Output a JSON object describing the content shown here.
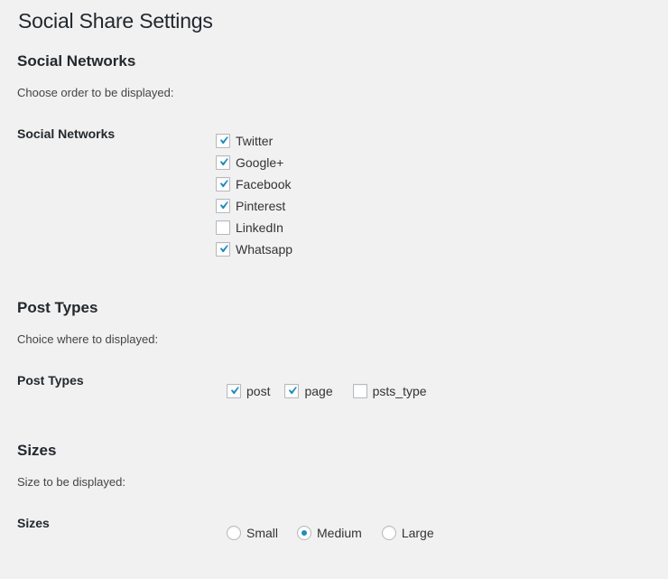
{
  "page": {
    "title": "Social Share Settings"
  },
  "social_networks": {
    "heading": "Social Networks",
    "description": "Choose order to be displayed:",
    "field_label": "Social Networks",
    "options": [
      {
        "label": "Twitter",
        "checked": true
      },
      {
        "label": "Google+",
        "checked": true
      },
      {
        "label": "Facebook",
        "checked": true
      },
      {
        "label": "Pinterest",
        "checked": true
      },
      {
        "label": "LinkedIn",
        "checked": false
      },
      {
        "label": "Whatsapp",
        "checked": true
      }
    ]
  },
  "post_types": {
    "heading": "Post Types",
    "description": "Choice where to displayed:",
    "field_label": "Post Types",
    "options": [
      {
        "label": "post",
        "checked": true
      },
      {
        "label": "page",
        "checked": true
      },
      {
        "label": "psts_type",
        "checked": false
      }
    ]
  },
  "sizes": {
    "heading": "Sizes",
    "description": "Size to be displayed:",
    "field_label": "Sizes",
    "options": [
      {
        "label": "Small",
        "selected": false
      },
      {
        "label": "Medium",
        "selected": true
      },
      {
        "label": "Large",
        "selected": false
      }
    ]
  },
  "colors": {
    "check": "#1e8cbe",
    "accent": "#1e8cbe"
  }
}
